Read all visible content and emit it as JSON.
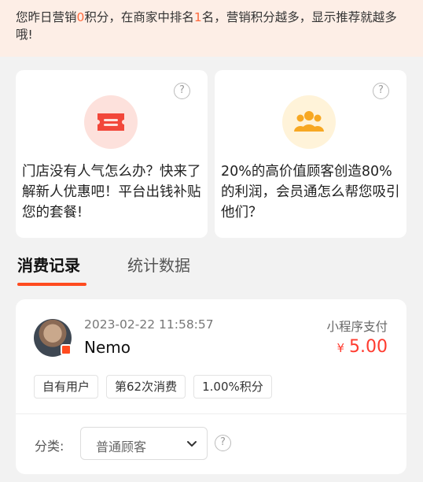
{
  "notice": {
    "prefix": "您昨日营销",
    "points": "0",
    "mid": "积分，在商家中排名",
    "rank": "1",
    "suffix": "名，营销积分越多，显示推荐就越多哦!"
  },
  "cards": [
    {
      "icon": "coupon-icon",
      "text": "门店没有人气怎么办？快来了解新人优惠吧！平台出钱补贴您的套餐!",
      "help": "?"
    },
    {
      "icon": "members-icon",
      "text": "20%的高价值顾客创造80%的利润，会员通怎么帮您吸引他们？",
      "help": "?"
    }
  ],
  "tabs": [
    {
      "label": "消费记录",
      "active": true
    },
    {
      "label": "统计数据",
      "active": false
    }
  ],
  "record": {
    "time": "2023-02-22 11:58:57",
    "name": "Nemo",
    "pay_method": "小程序支付",
    "currency": "¥",
    "amount": "5.00",
    "tags": [
      "自有用户",
      "第62次消费",
      "1.00%积分"
    ],
    "category_label": "分类:",
    "category_value": "普通顾客",
    "help": "?"
  },
  "colors": {
    "accent": "#ff4b1f",
    "price": "#ff3b2f",
    "notice_bg": "#fdeee6",
    "highlight": "#ff6a3d"
  }
}
